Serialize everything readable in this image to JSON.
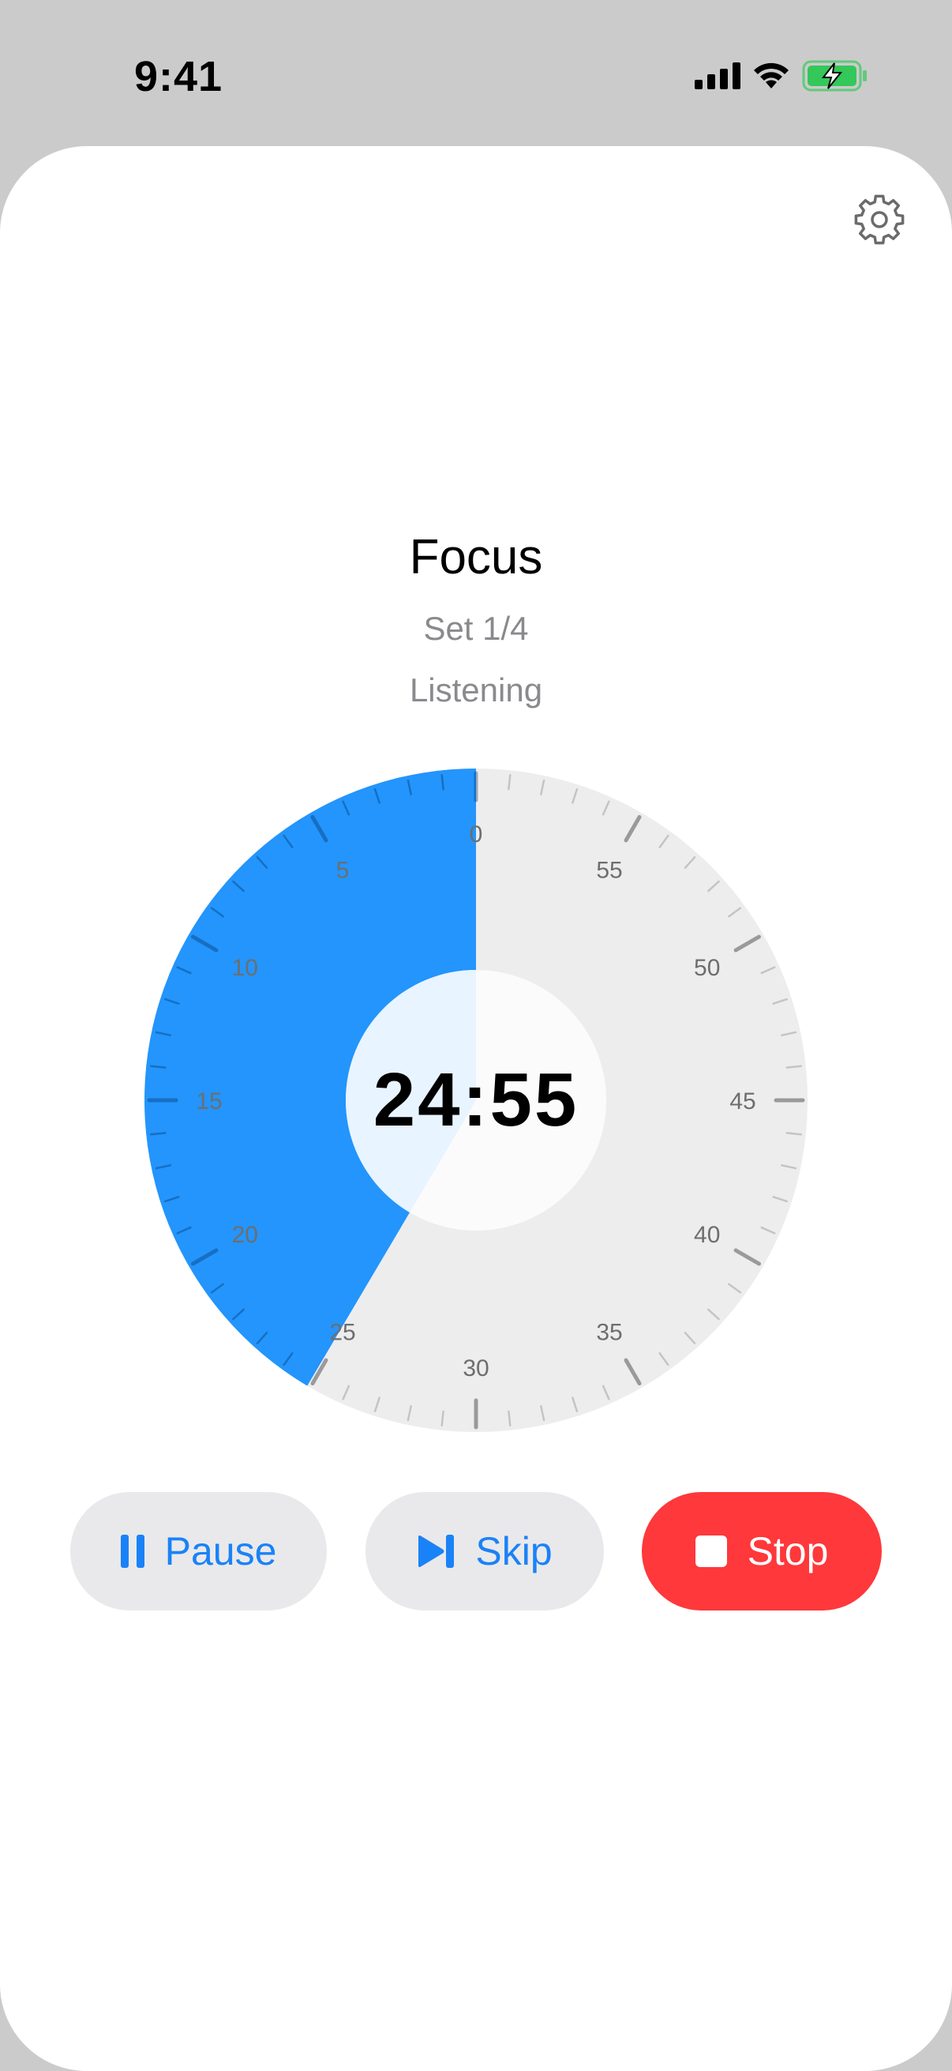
{
  "status_bar": {
    "time": "9:41",
    "icons": [
      "cellular-signal-icon",
      "wifi-icon",
      "battery-charging-icon"
    ],
    "battery_color": "#34c759"
  },
  "header": {
    "settings_icon": "gear-icon"
  },
  "session": {
    "title": "Focus",
    "set_label": "Set 1/4",
    "status": "Listening"
  },
  "timer": {
    "display": "24:55",
    "elapsed_fraction": 0.415,
    "dial_labels": [
      "0",
      "5",
      "10",
      "15",
      "20",
      "25",
      "30",
      "35",
      "40",
      "45",
      "50",
      "55"
    ],
    "dial_values": [
      0,
      5,
      10,
      15,
      20,
      25,
      30,
      35,
      40,
      45,
      50,
      55
    ],
    "dial_max": 60
  },
  "controls": {
    "pause_label": "Pause",
    "pause_icon": "pause-icon",
    "skip_label": "Skip",
    "skip_icon": "skip-forward-icon",
    "stop_label": "Stop",
    "stop_icon": "stop-icon"
  },
  "colors": {
    "accent": "#2395fc",
    "accent_light": "#e8f4ff",
    "dial_background": "#ededed",
    "stop": "#fe383b",
    "button_background": "#e9e9eb",
    "button_text": "#1a82f7"
  }
}
